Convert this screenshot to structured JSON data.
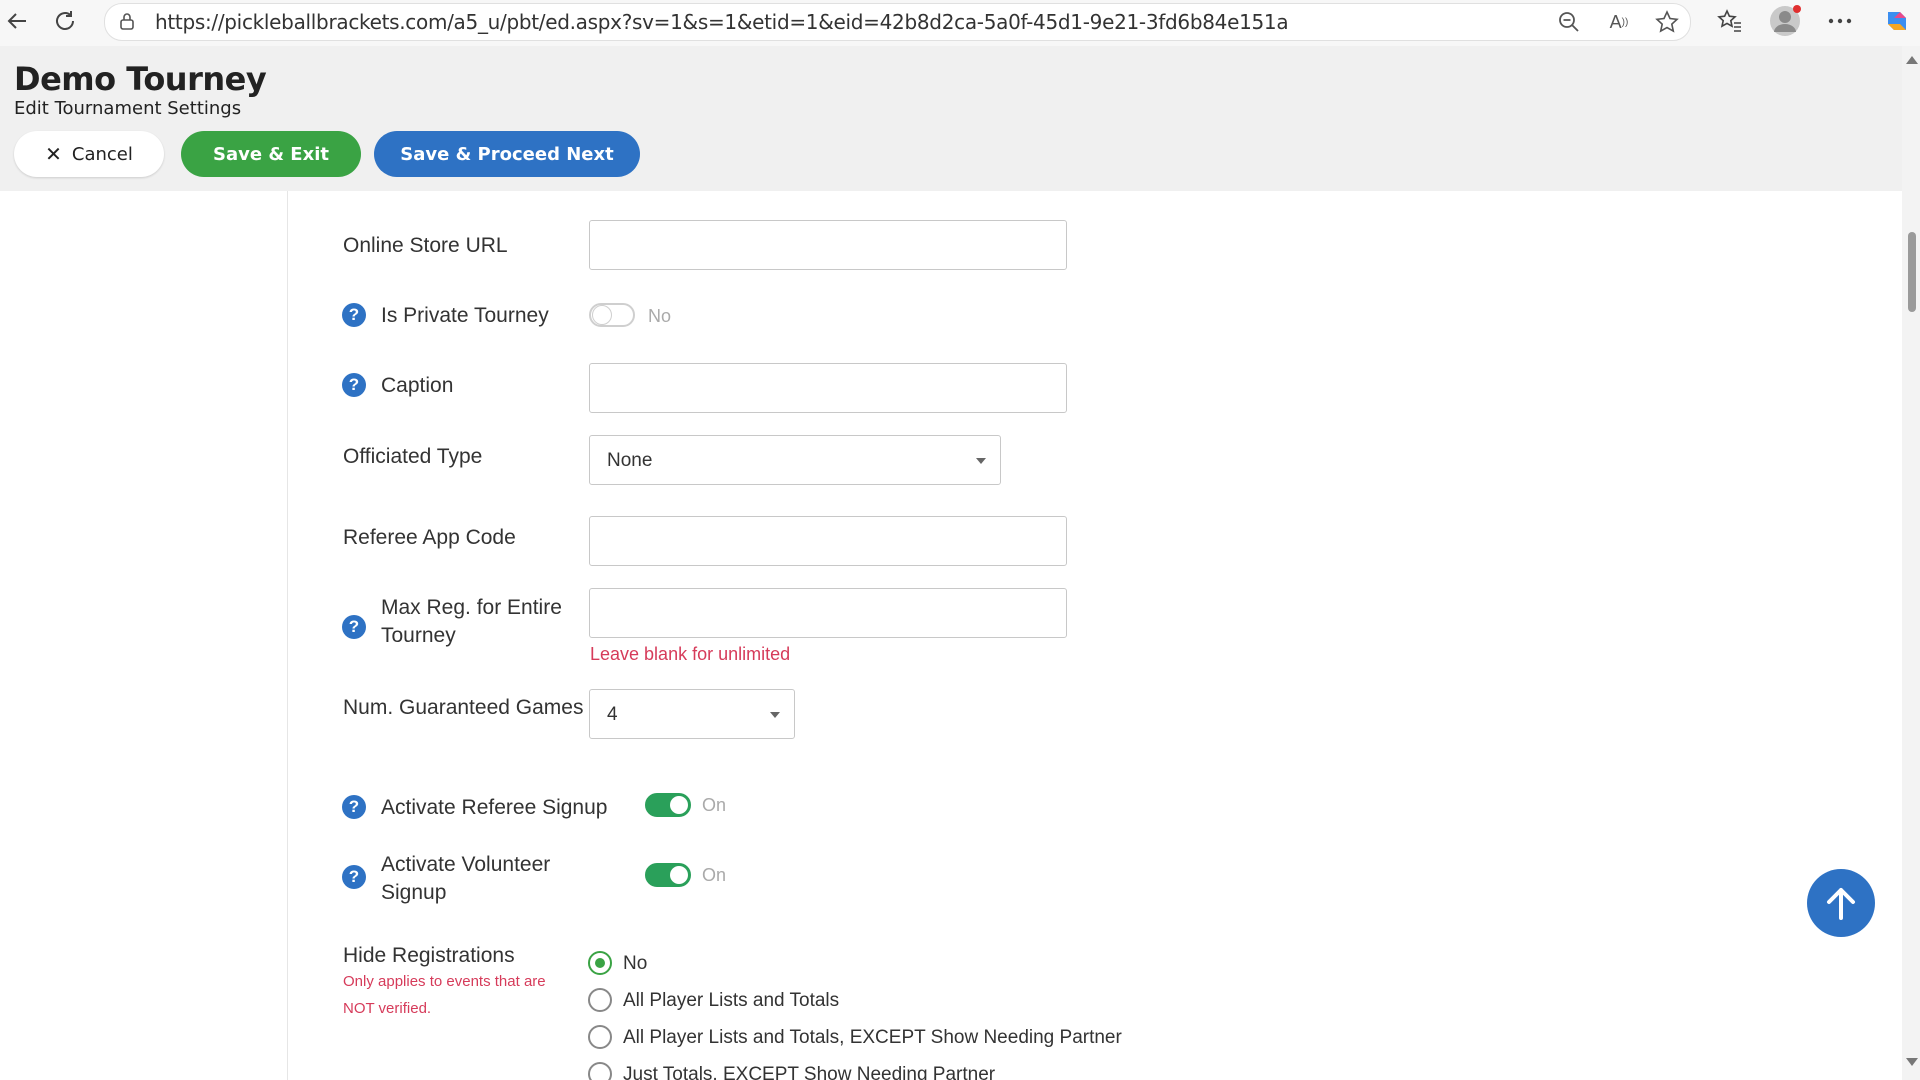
{
  "browser": {
    "url": "https://pickleballbrackets.com/a5_u/pbt/ed.aspx?sv=1&s=1&etid=1&eid=42b8d2ca-5a0f-45d1-9e21-3fd6b84e151a"
  },
  "header": {
    "title": "Demo Tourney",
    "subtitle": "Edit Tournament Settings",
    "cancel_label": "Cancel",
    "save_exit_label": "Save & Exit",
    "save_next_label": "Save & Proceed Next"
  },
  "form": {
    "online_store_url": {
      "label": "Online Store URL",
      "value": ""
    },
    "is_private_tourney": {
      "label": "Is Private Tourney",
      "state": "No"
    },
    "caption": {
      "label": "Caption",
      "value": ""
    },
    "officiated_type": {
      "label": "Officiated Type",
      "selected": "None"
    },
    "referee_app_code": {
      "label": "Referee App Code",
      "value": ""
    },
    "max_reg": {
      "label_line1": "Max Reg. for Entire",
      "label_line2": "Tourney",
      "value": "",
      "hint": "Leave blank for unlimited"
    },
    "num_guaranteed_games": {
      "label": "Num. Guaranteed Games",
      "selected": "4"
    },
    "activate_referee_signup": {
      "label": "Activate Referee Signup",
      "state": "On"
    },
    "activate_volunteer_signup": {
      "label_line1": "Activate Volunteer",
      "label_line2": "Signup",
      "state": "On"
    },
    "hide_registrations": {
      "label": "Hide Registrations",
      "note_line1": "Only applies to events that are",
      "note_line2": "NOT verified.",
      "options": [
        {
          "label": "No",
          "checked": true
        },
        {
          "label": "All Player Lists and Totals",
          "checked": false
        },
        {
          "label": "All Player Lists and Totals, EXCEPT Show Needing Partner",
          "checked": false
        },
        {
          "label": "Just Totals, EXCEPT Show Needing Partner",
          "checked": false
        }
      ]
    }
  },
  "colors": {
    "primary": "#2e72c4",
    "success": "#3aa344",
    "toggle_on": "#2aa05a",
    "hint": "#d63b5a"
  }
}
